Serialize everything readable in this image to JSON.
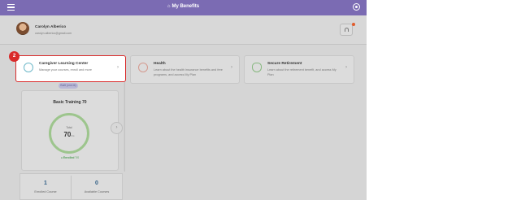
{
  "header": {
    "title": "My Benefits",
    "menu_icon": "hamburger-icon",
    "home_icon": "home-icon",
    "settings_icon": "settings-icon",
    "color": "#7b6bb3"
  },
  "user": {
    "name": "Carolyn Alberico",
    "email": "carolyn.alberico@gmail.com"
  },
  "notifications": {
    "icon": "bell-icon",
    "dot_color": "#e25c2c"
  },
  "step_marker": "2",
  "cards": [
    {
      "title": "Caregiver Learning Center",
      "desc": "Manage your courses, enroll and more",
      "icon": "lightbulb-icon"
    },
    {
      "title": "Health",
      "desc": "Learn about the health insurance benefits and free programs, and access My Plan",
      "icon": "heart-icon"
    },
    {
      "title": "Secure Retirement",
      "desc": "Learn about the retirement benefit, and access My Plan",
      "icon": "shield-icon"
    }
  ],
  "training": {
    "tag": "Built (one.bt)",
    "title": "Basic Training 70",
    "total_label": "Total",
    "total_value": "70",
    "total_unit": "hrs",
    "status_label": "Enrolled",
    "status_value": "7/0"
  },
  "stats": [
    {
      "value": "1",
      "label": "Enrolled Course"
    },
    {
      "value": "0",
      "label": "Available Courses"
    }
  ]
}
